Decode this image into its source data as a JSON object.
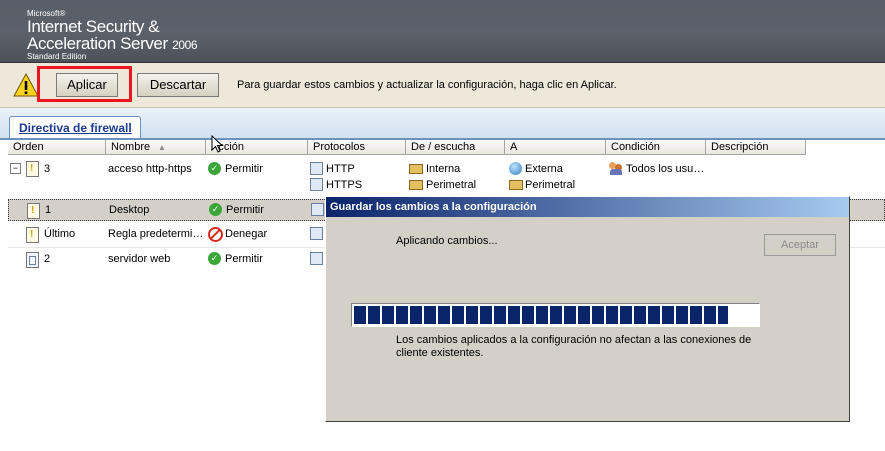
{
  "header": {
    "brand_ms": "Microsoft®",
    "product_line1": "Internet Security &",
    "product_line2": "Acceleration Server",
    "year": "2006",
    "edition": "Standard Edition"
  },
  "toolbar": {
    "apply_label": "Aplicar",
    "discard_label": "Descartar",
    "message": "Para guardar estos cambios y actualizar la configuración, haga clic en Aplicar."
  },
  "tabs": [
    {
      "label": "Directiva de firewall"
    }
  ],
  "grid": {
    "columns": [
      "Orden",
      "Nombre",
      "Acción",
      "Protocolos",
      "De / escucha",
      "A",
      "Condición",
      "Descripción"
    ],
    "rows": [
      {
        "order": "3",
        "name": "acceso http-https",
        "action": "Permitir",
        "protocols": [
          "HTTP",
          "HTTPS"
        ],
        "from": [
          "Interna",
          "Perimetral"
        ],
        "to": [
          "Externa",
          "Perimetral"
        ],
        "condition": "Todos los usu…",
        "description": ""
      },
      {
        "order": "1",
        "name": "Desktop",
        "action": "Permitir",
        "protocols": [],
        "from": [],
        "to": [],
        "condition": "",
        "description": ""
      },
      {
        "order": "Último",
        "name": "Regla predetermi…",
        "action": "Denegar",
        "protocols": [],
        "from": [],
        "to": [],
        "condition": "",
        "description": ""
      },
      {
        "order": "2",
        "name": "servidor web",
        "action": "Permitir",
        "protocols": [],
        "from": [],
        "to": [],
        "condition": "",
        "description": ""
      }
    ]
  },
  "dialog": {
    "title": "Guardar los cambios a la configuración",
    "status": "Aplicando cambios...",
    "accept_label": "Aceptar",
    "progress_fraction": 0.92,
    "note": "Los cambios aplicados a la configuración no afectan a las conexiones de cliente existentes."
  },
  "colors": {
    "header_bg": "#5b6169",
    "highlight_red": "#e8151e",
    "progress_blue": "#0a246a",
    "link_blue": "#1b3a8f"
  }
}
